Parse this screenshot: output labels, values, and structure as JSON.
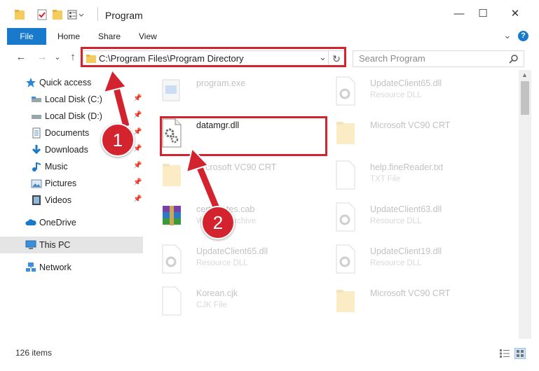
{
  "window": {
    "title": "Program",
    "minimize": "—",
    "maximize": "☐",
    "close": "✕"
  },
  "ribbon": {
    "tabs": [
      "File",
      "Home",
      "Share",
      "View"
    ],
    "help": "?",
    "expand": "⌄"
  },
  "nav": {
    "address": "C:\\Program Files\\Program Directory",
    "search_placeholder": "Search Program",
    "back": "←",
    "forward": "→",
    "up": "↑",
    "recent": "⌄",
    "refresh": "↻",
    "dropdown": "⌄"
  },
  "sidebar": {
    "items": [
      {
        "label": "Quick access",
        "icon": "star-icon"
      },
      {
        "label": "Local Disk (C:)",
        "icon": "drive-icon",
        "pinned": true
      },
      {
        "label": "Local Disk (D:)",
        "icon": "drive-icon",
        "pinned": true
      },
      {
        "label": "Documents",
        "icon": "documents-icon",
        "pinned": true
      },
      {
        "label": "Downloads",
        "icon": "download-icon",
        "pinned": true
      },
      {
        "label": "Music",
        "icon": "music-icon",
        "pinned": true
      },
      {
        "label": "Pictures",
        "icon": "pictures-icon",
        "pinned": true
      },
      {
        "label": "Videos",
        "icon": "videos-icon",
        "pinned": true
      },
      {
        "label": "OneDrive",
        "icon": "cloud-icon"
      },
      {
        "label": "This PC",
        "icon": "computer-icon",
        "selected": true
      },
      {
        "label": "Network",
        "icon": "network-icon"
      }
    ],
    "pin_glyph": "📌"
  },
  "files": [
    {
      "name": "program.exe",
      "type": "",
      "icon": "exe-icon"
    },
    {
      "name": "UpdateClient65.dll",
      "type": "Resource DLL",
      "icon": "dll-icon"
    },
    {
      "name": "datamgr.dll",
      "type": "",
      "icon": "dll-gear-icon",
      "highlight": true
    },
    {
      "name": "Microsoft VC90 CRT",
      "type": "",
      "icon": "folder-icon"
    },
    {
      "name": "Microsoft VC90 CRT",
      "type": "",
      "icon": "folder-icon"
    },
    {
      "name": "help.fineReader.txt",
      "type": "TXT File",
      "icon": "txt-icon"
    },
    {
      "name": "certificates.cab",
      "type": "WinRAR Archive",
      "icon": "rar-icon"
    },
    {
      "name": "UpdateClient63.dll",
      "type": "Resource DLL",
      "icon": "dll-icon"
    },
    {
      "name": "UpdateClient65.dll",
      "type": "Resource DLL",
      "icon": "dll-icon"
    },
    {
      "name": "UpdateClient19.dll",
      "type": "Resource DLL",
      "icon": "dll-icon"
    },
    {
      "name": "Korean.cjk",
      "type": "CJK File",
      "icon": "blank-file-icon"
    },
    {
      "name": "Microsoft VC90 CRT",
      "type": "",
      "icon": "folder-icon"
    }
  ],
  "status": {
    "count": "126 items"
  },
  "annotations": {
    "step1": "1",
    "step2": "2"
  },
  "colors": {
    "accent": "#1979ca",
    "highlight": "#d2232f"
  }
}
